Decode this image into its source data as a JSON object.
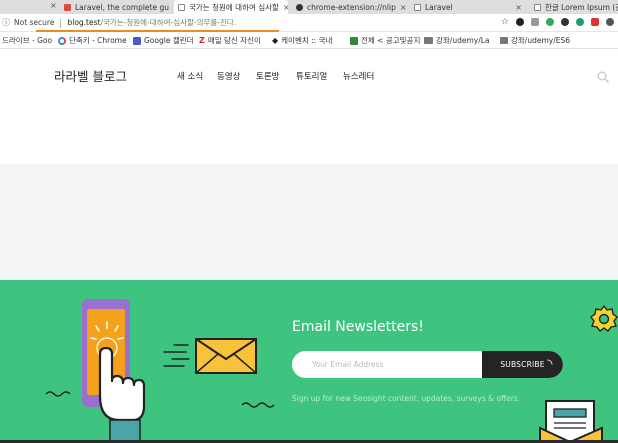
{
  "browser": {
    "tabs": [
      {
        "label": "Laravel, the complete gu",
        "active": false,
        "icon": "laravel-icon"
      },
      {
        "label": "국가는 청원에 대하여 심사할",
        "active": true,
        "icon": "page-icon"
      },
      {
        "label": "chrome-extension://nlip",
        "active": false,
        "icon": "extension-icon"
      },
      {
        "label": "Laravel",
        "active": false,
        "icon": "page-icon"
      },
      {
        "label": "한글 Lorem Ipsum (간사",
        "active": false,
        "icon": "page-icon"
      }
    ],
    "security_label": "Not secure",
    "url_host": "blog.test",
    "url_path": "/국가는-청원에-대하여-심사할-의무를-진다.",
    "bookmarks": [
      {
        "label": "드라이브 - Goo",
        "icon": "drive-icon"
      },
      {
        "label": "단축키 - Chrome",
        "icon": "google-icon"
      },
      {
        "label": "Google 캘린더",
        "icon": "calendar-icon"
      },
      {
        "label": "매일 당신 자신이",
        "icon": "z-icon"
      },
      {
        "label": "케이벤치 :: 국내",
        "icon": "kbench-icon"
      },
      {
        "label": "전체 < 공고및공지",
        "icon": "news-icon"
      },
      {
        "label": "강좌/udemy/La",
        "icon": "folder-icon"
      },
      {
        "label": "강좌/udemy/ES6",
        "icon": "folder-icon"
      }
    ]
  },
  "site": {
    "logo": "라라벨 블로그",
    "nav": [
      "새 소식",
      "동영상",
      "토론방",
      "튜토리얼",
      "뉴스레터"
    ]
  },
  "newsletter": {
    "title": "Email Newsletters!",
    "placeholder": "Your Email Address",
    "button": "SUBSCRIBE",
    "subtext": "Sign up for new Seosight content, updates, surveys & offers."
  },
  "colors": {
    "footer_green": "#3ec47e",
    "accent_orange": "#f08a24",
    "button_dark": "#242424"
  }
}
